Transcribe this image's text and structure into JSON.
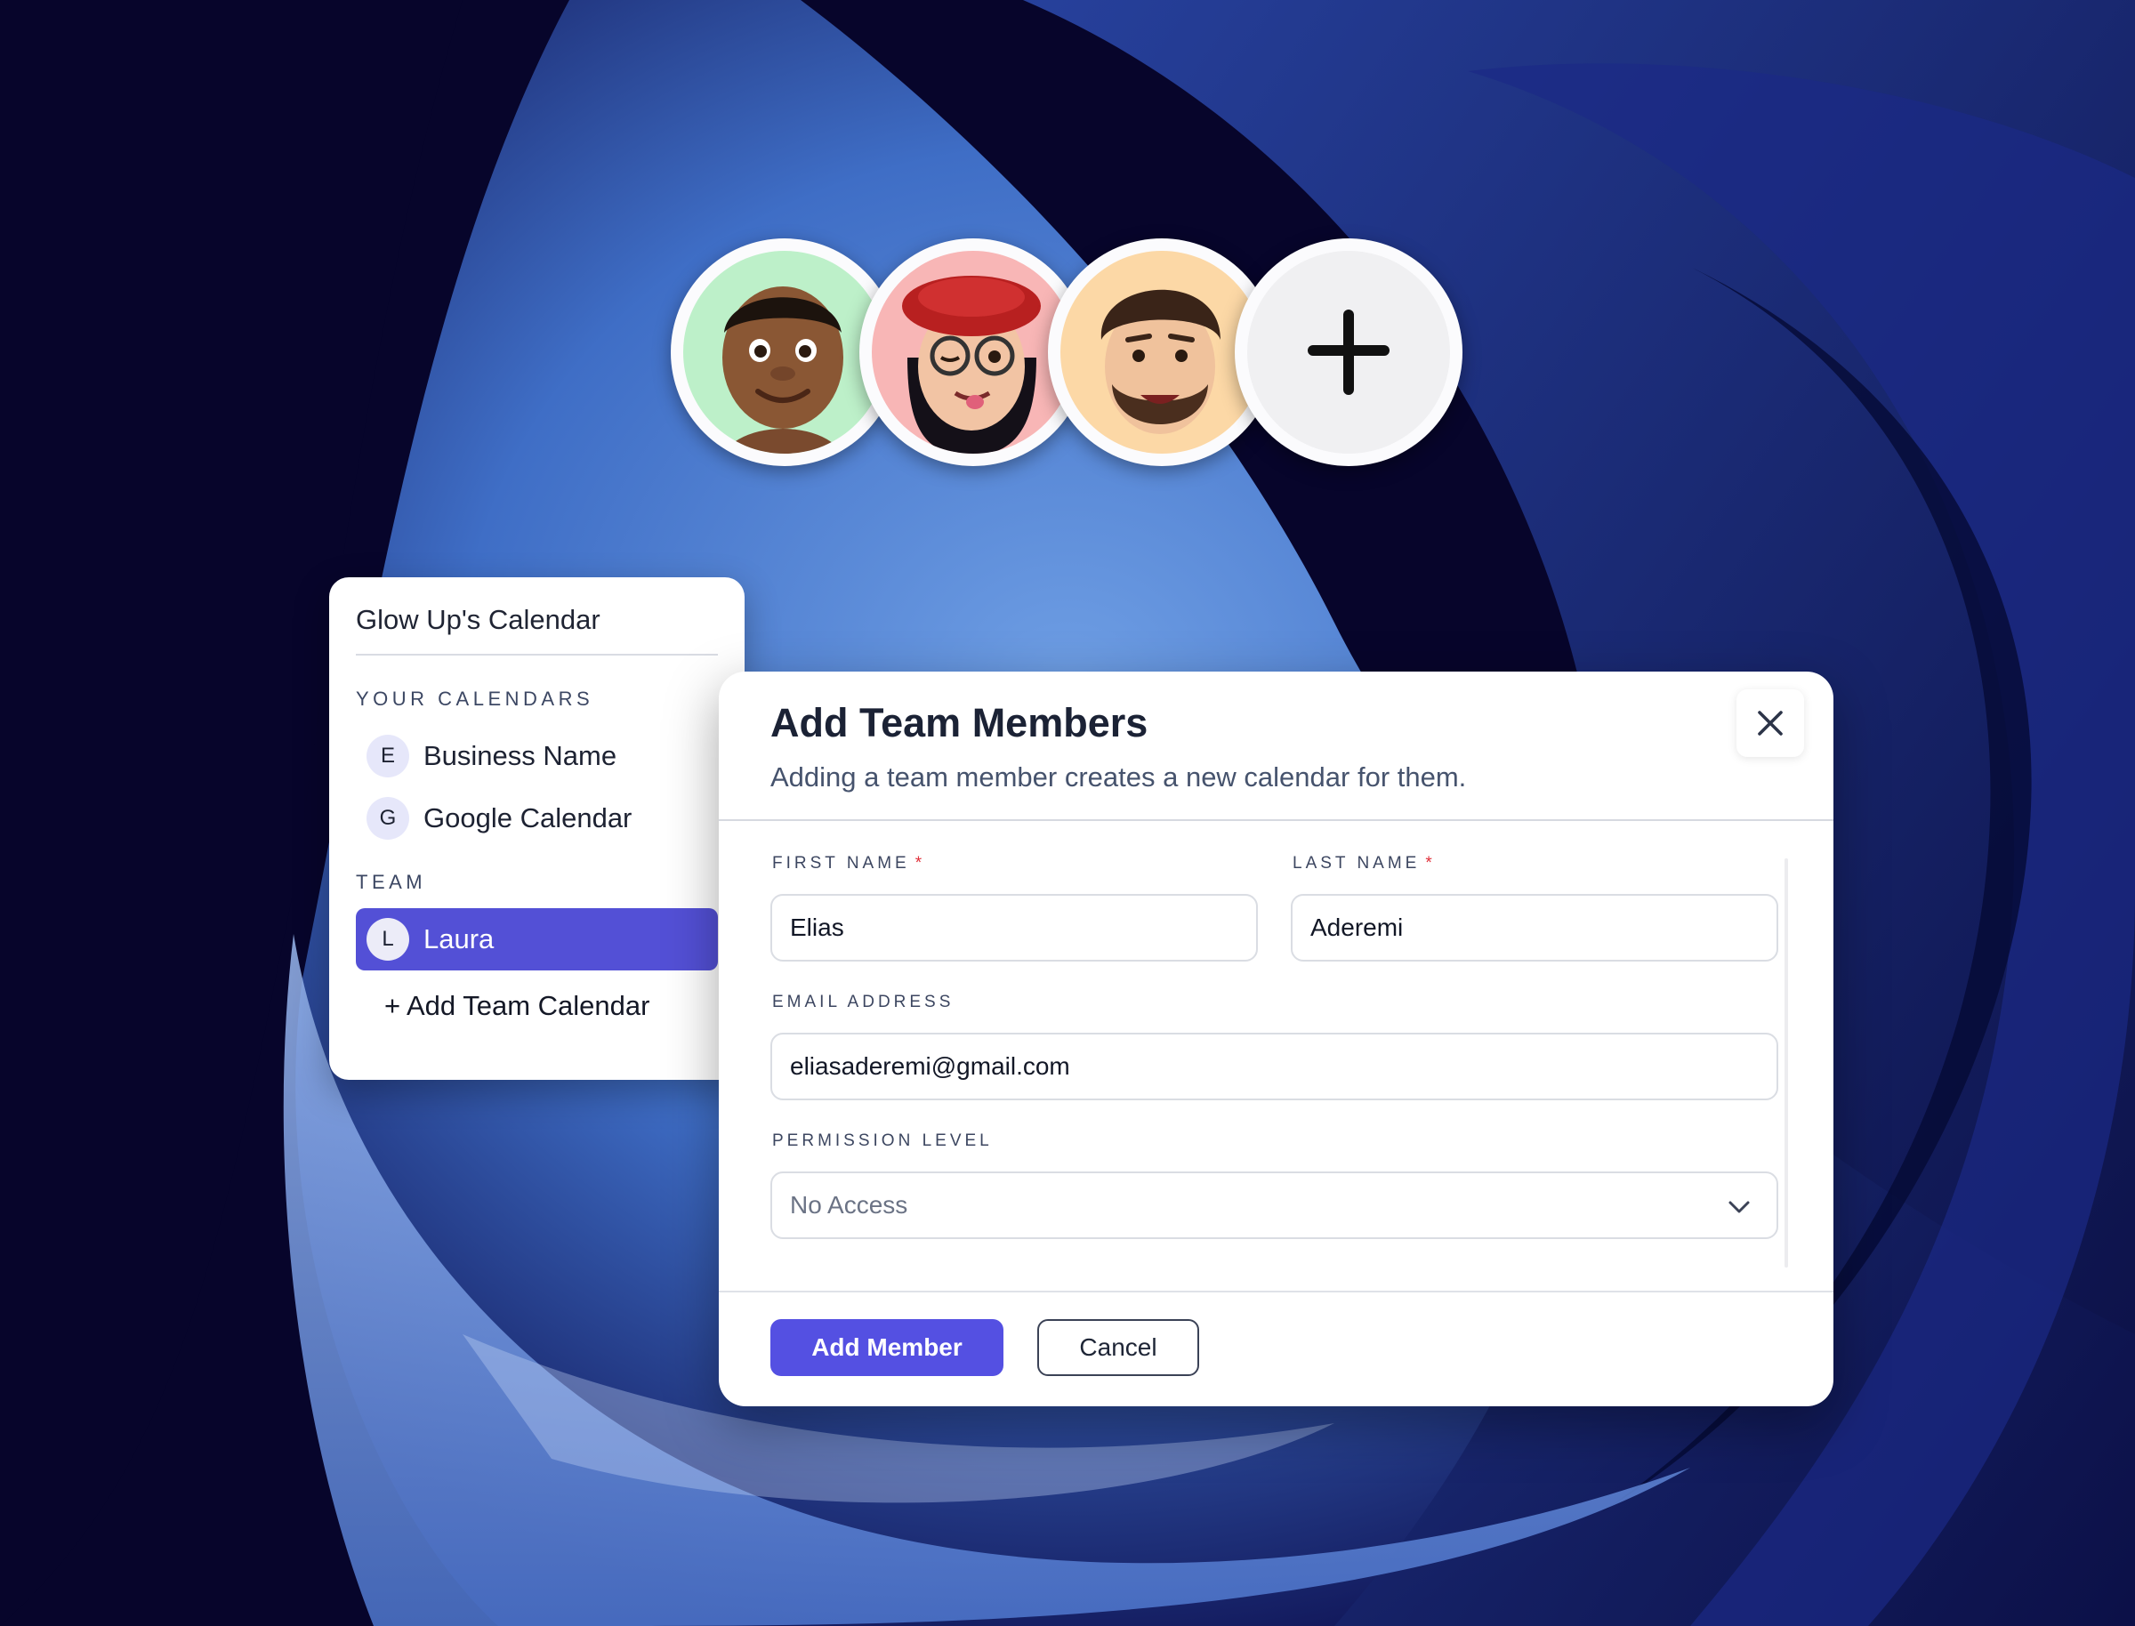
{
  "calendar_panel": {
    "title": "Glow Up's Calendar",
    "your_calendars_heading": "YOUR CALENDARS",
    "calendars": [
      {
        "badge": "E",
        "label": "Business Name"
      },
      {
        "badge": "G",
        "label": "Google Calendar"
      }
    ],
    "team_heading": "TEAM",
    "team": [
      {
        "badge": "L",
        "label": "Laura",
        "selected": true
      }
    ],
    "add_team_calendar": "+ Add Team Calendar"
  },
  "avatars": [
    {
      "name": "avatar-green",
      "bg": "#bdf0c9"
    },
    {
      "name": "avatar-pink",
      "bg": "#f8b6b6"
    },
    {
      "name": "avatar-orange",
      "bg": "#fcd8a6"
    },
    {
      "name": "add-member-avatar",
      "icon": "plus-icon"
    }
  ],
  "modal": {
    "title": "Add Team Members",
    "subtitle": "Adding a team member creates a new calendar for them.",
    "close_icon": "close-icon",
    "fields": {
      "first_name": {
        "label": "FIRST NAME",
        "required_mark": "*",
        "value": "Elias"
      },
      "last_name": {
        "label": "LAST NAME",
        "required_mark": "*",
        "value": "Aderemi"
      },
      "email": {
        "label": "EMAIL ADDRESS",
        "value": "eliasaderemi@gmail.com"
      },
      "permission": {
        "label": "PERMISSION LEVEL",
        "value": "No Access"
      }
    },
    "add_button": "Add Member",
    "cancel_button": "Cancel"
  },
  "colors": {
    "accent": "#5450e2",
    "selected_item": "#5350d6",
    "required": "#e0303a",
    "background": "#07052b"
  }
}
